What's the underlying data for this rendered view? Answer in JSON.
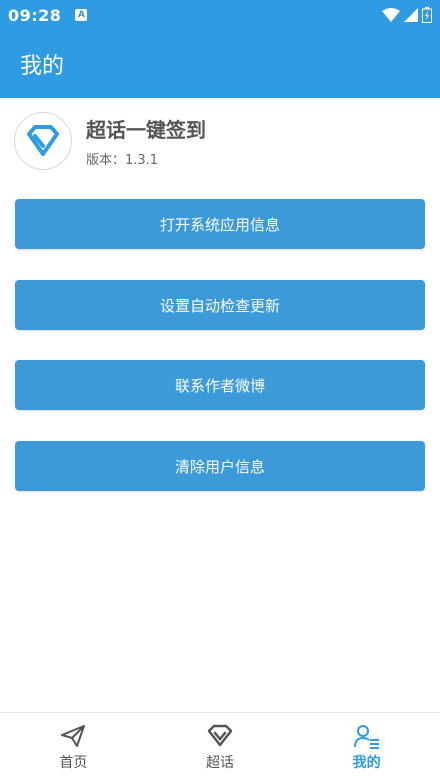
{
  "status_bar": {
    "time": "09:28",
    "notification_badge": "A"
  },
  "app_bar": {
    "title": "我的"
  },
  "app_info": {
    "name": "超话一键签到",
    "version": "版本：1.3.1",
    "logo_icon": "diamond-icon"
  },
  "actions": [
    {
      "label": "打开系统应用信息"
    },
    {
      "label": "设置自动检查更新"
    },
    {
      "label": "联系作者微博"
    },
    {
      "label": "清除用户信息"
    }
  ],
  "bottom_nav": [
    {
      "label": "首页",
      "icon": "paper-plane-icon",
      "active": false
    },
    {
      "label": "超话",
      "icon": "diamond-icon",
      "active": false
    },
    {
      "label": "我的",
      "icon": "user-list-icon",
      "active": true
    }
  ],
  "colors": {
    "primary": "#2f9be3",
    "button": "#3d9ad8",
    "text_dark": "#555555"
  }
}
